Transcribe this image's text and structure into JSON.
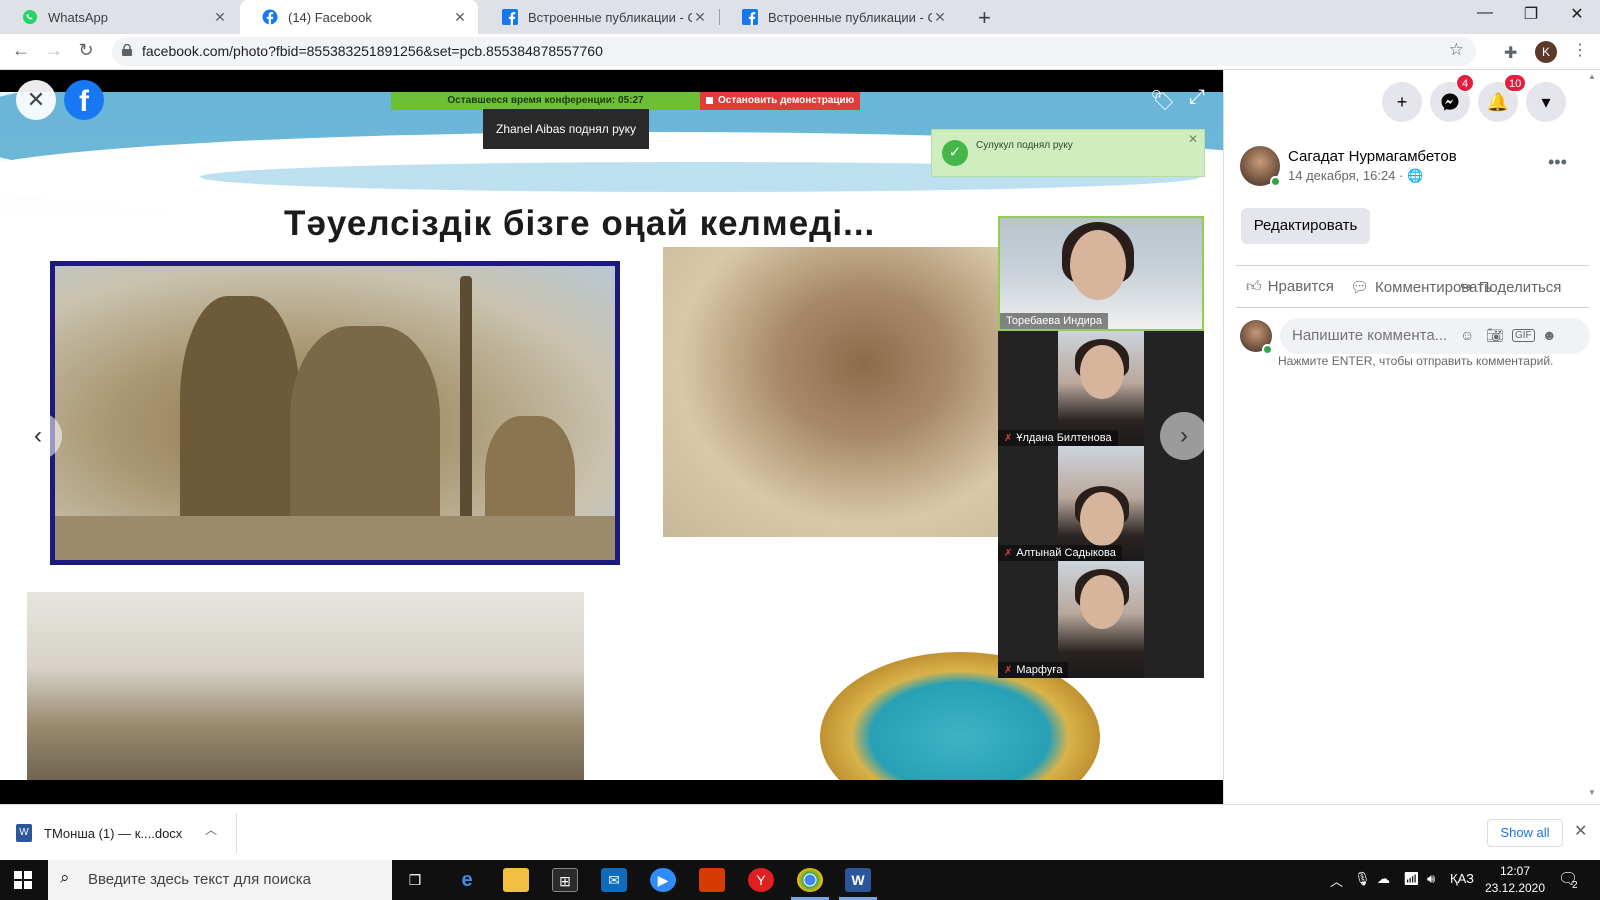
{
  "browser": {
    "tabs": [
      {
        "title": "WhatsApp",
        "icon": "whatsapp-icon",
        "active": false
      },
      {
        "title": "(14) Facebook",
        "icon": "facebook-icon",
        "active": true
      },
      {
        "title": "Встроенные публикации - Соц",
        "icon": "facebook-icon",
        "active": false
      },
      {
        "title": "Встроенные публикации - Соц",
        "icon": "facebook-icon",
        "active": false
      }
    ],
    "url": "facebook.com/photo?fbid=855383251891256&set=pcb.855384878557760",
    "profile_initial": "K"
  },
  "zoom": {
    "timer_text": "Оставшееся время конференции: 05:27",
    "stop_text": "Остановить демонстрацию",
    "raise_hand_tooltip": "Zhanel Aibas поднял руку",
    "notification": "Сулукул поднял руку",
    "participants": [
      {
        "name": "Торебаева Индира"
      },
      {
        "name": "Ұлдана Билтенова"
      },
      {
        "name": "Алтынай Садыкова"
      },
      {
        "name": "Марфуға"
      }
    ]
  },
  "slide": {
    "title": "Тәуелсіздік бізге оңай келмеді..."
  },
  "facebook": {
    "logo": "f",
    "messenger_badge": "4",
    "notifications_badge": "10",
    "author": "Сагадат Нурмагамбетов",
    "date": "14 декабря, 16:24 ·",
    "edit_label": "Редактировать",
    "actions": {
      "like": "Нравится",
      "comment": "Комментировать",
      "share": "Поделиться"
    },
    "comment_placeholder": "Напишите коммента...",
    "enter_hint": "Нажмите ENTER, чтобы отправить комментарий."
  },
  "downloads": {
    "file_name": "ТМонша (1) — к....docx",
    "show_all": "Show all"
  },
  "taskbar": {
    "search_placeholder": "Введите здесь текст для поиска",
    "lang": "ҚАЗ",
    "time": "12:07",
    "date": "23.12.2020",
    "notify_count": "2"
  },
  "colors": {
    "facebook_blue": "#1877f2",
    "badge_red": "#e41e3f",
    "zoom_green": "#6dc036",
    "zoom_red": "#e23b3b"
  }
}
